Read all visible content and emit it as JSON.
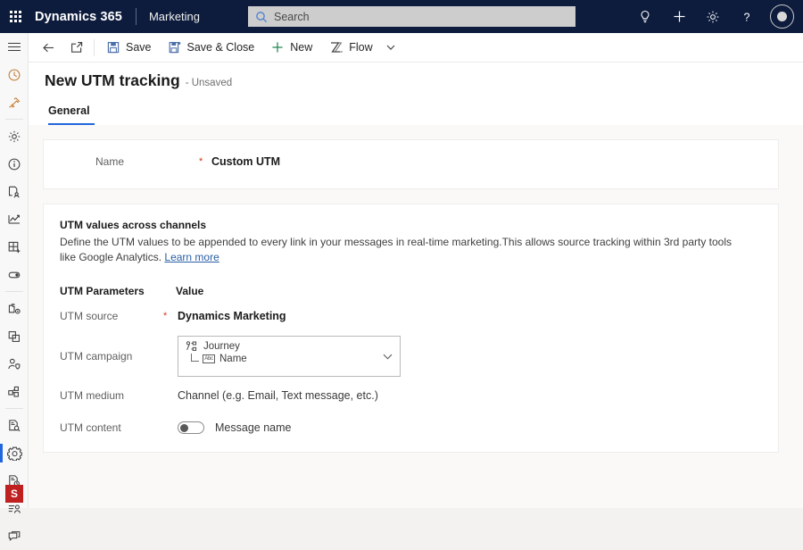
{
  "topbar": {
    "waffle_label": "app-launcher",
    "brand": "Dynamics 365",
    "app_name": "Marketing",
    "search": {
      "placeholder": "Search",
      "value": "",
      "icon": "search-icon"
    },
    "actions": [
      {
        "name": "lightbulb-icon",
        "label": "Ideas"
      },
      {
        "name": "plus-icon",
        "label": "New"
      },
      {
        "name": "gear-icon",
        "label": "Settings"
      },
      {
        "name": "question-icon",
        "label": "Help"
      }
    ],
    "avatar": {
      "name": "avatar",
      "initials": ""
    },
    "colors": {
      "bar_bg": "#0d1c3d",
      "search_bg": "#cdcdcd",
      "search_icon": "#4a7fd1"
    }
  },
  "rail": {
    "menu_label": "Site map",
    "items": [
      {
        "icon": "hamburger-menu-icon",
        "label": "Show site map",
        "selected": false
      },
      {
        "icon": "recent-clock-icon",
        "label": "Recent",
        "selected": false
      },
      {
        "icon": "pin-icon",
        "label": "Pinned",
        "selected": false
      },
      {
        "icon": "gear-icon",
        "label": "Settings",
        "selected": false
      },
      {
        "icon": "info-circle-icon",
        "label": "Overview",
        "selected": false
      },
      {
        "icon": "contact-person-document-icon",
        "label": "Contacts",
        "selected": false
      },
      {
        "icon": "analytics-chart-icon",
        "label": "Analytics",
        "selected": false
      },
      {
        "icon": "grid-plus-icon",
        "label": "New grid",
        "selected": false
      },
      {
        "icon": "toggle-switch-icon",
        "label": "Feature switches",
        "selected": false
      },
      {
        "icon": "folder-gear-icon",
        "label": "Asset settings",
        "selected": false
      },
      {
        "icon": "copy-duplicate-icon",
        "label": "Templates",
        "selected": false
      },
      {
        "icon": "person-shield-icon",
        "label": "Consent",
        "selected": false
      },
      {
        "icon": "segment-node-icon",
        "label": "Segments",
        "selected": false
      },
      {
        "icon": "document-search-icon",
        "label": "Audit",
        "selected": false
      },
      {
        "icon": "puzzle-gear-icon",
        "label": "UTM tracking",
        "selected": true
      },
      {
        "icon": "document-clock-icon",
        "label": "Scheduled",
        "selected": false
      },
      {
        "icon": "list-person-icon",
        "label": "Subscriptions",
        "selected": false
      },
      {
        "icon": "chat-bubble-icon",
        "label": "Messages",
        "selected": false
      }
    ],
    "bottom_badge": {
      "icon": "s-badge-icon",
      "label": "S"
    },
    "colors": {
      "bg": "#f8f8f8",
      "selected_bar": "#2266dd",
      "badge_bg": "#bf2020"
    }
  },
  "commandbar": {
    "back": {
      "icon": "back-arrow-icon",
      "label": "Back"
    },
    "popout": {
      "icon": "popout-window-icon",
      "label": "Open in new window"
    },
    "buttons": [
      {
        "icon": "save-floppy-icon",
        "label": "Save"
      },
      {
        "icon": "save-and-close-icon",
        "label": "Save & Close"
      },
      {
        "icon": "plus-icon",
        "label": "New"
      },
      {
        "icon": "flow-icon",
        "label": "Flow"
      }
    ],
    "flow_chevron": {
      "icon": "chevron-down-icon",
      "label": "More flow commands"
    }
  },
  "page": {
    "title": "New UTM tracking",
    "status": "- Unsaved",
    "tabs": [
      {
        "label": "General",
        "active": true
      }
    ]
  },
  "form": {
    "name_field": {
      "label": "Name",
      "required_marker": "*",
      "value": "Custom UTM"
    },
    "utm_section": {
      "title": "UTM values across channels",
      "description": "Define the UTM values to be appended to every link in your messages in real-time marketing.This allows source tracking within 3rd party tools like Google Analytics. ",
      "link": "Learn more",
      "columns": {
        "parameter": "UTM Parameters",
        "value": "Value"
      },
      "rows": [
        {
          "label": "UTM source",
          "required_marker": "*",
          "type": "text-bold",
          "value": "Dynamics Marketing"
        },
        {
          "label": "UTM campaign",
          "required_marker": "",
          "type": "combo",
          "combo": {
            "line1": {
              "icon": "journey-flow-icon",
              "text": "Journey"
            },
            "line2": {
              "icon": "abc-text-field-icon",
              "icon_text": "Abc",
              "text": "Name"
            },
            "chevron": "chevron-down-icon"
          }
        },
        {
          "label": "UTM medium",
          "required_marker": "",
          "type": "text-plain",
          "value": "Channel (e.g. Email, Text message, etc.)"
        },
        {
          "label": "UTM content",
          "required_marker": "",
          "type": "toggle",
          "toggle": {
            "checked": false,
            "label": "Message name"
          }
        }
      ]
    },
    "colors": {
      "required": "#d6391f",
      "link": "#2a5fa5",
      "card_bg": "#ffffff",
      "body_bg": "#faf9f8"
    }
  }
}
